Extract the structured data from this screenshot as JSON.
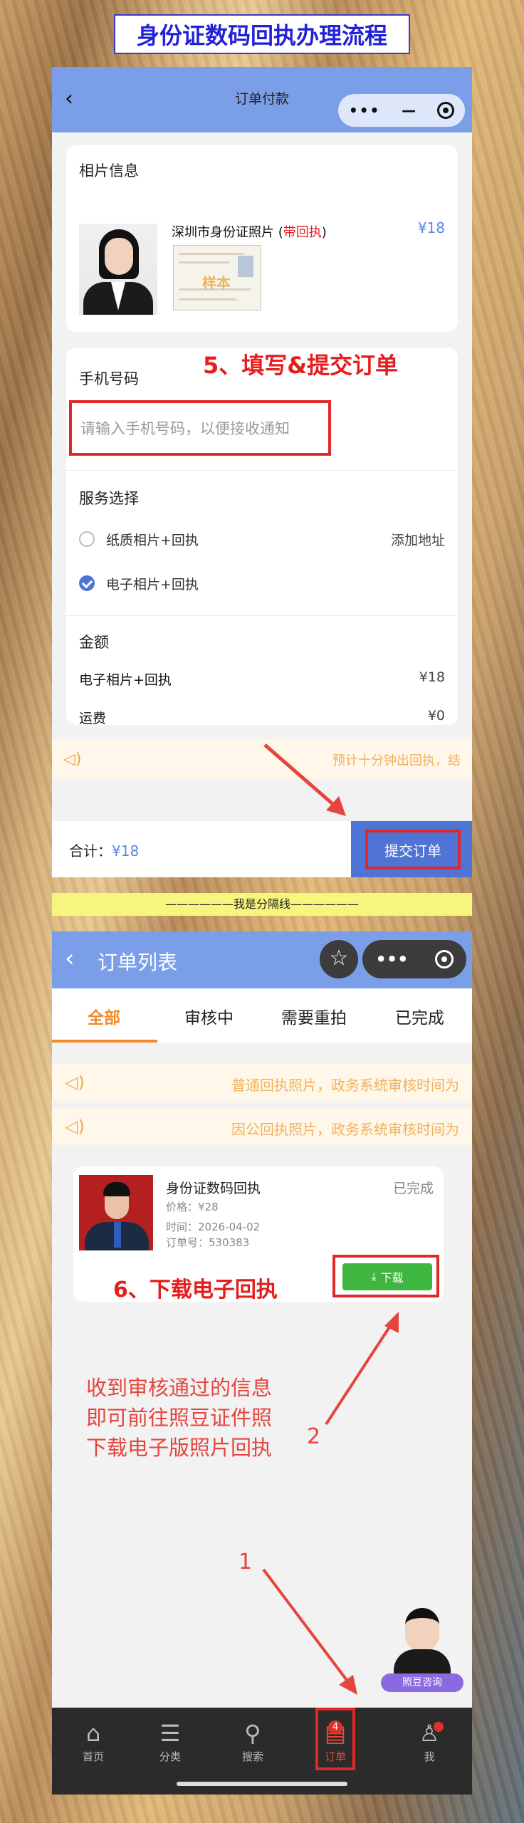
{
  "main_title": "身份证数码回执办理流程",
  "order_pay": {
    "nav_title": "订单付款",
    "photo_section_title": "相片信息",
    "product_name": "深圳市身份证照片",
    "product_tag": "带回执",
    "sample_stamp": "样本",
    "product_price": "¥18",
    "step_label": "5、填写&提交订单",
    "phone_label": "手机号码",
    "phone_placeholder": "请输入手机号码，以便接收通知",
    "service_title": "服务选择",
    "options": [
      {
        "label": "纸质相片+回执",
        "right": "添加地址",
        "selected": false
      },
      {
        "label": "电子相片+回执",
        "right": "",
        "selected": true
      }
    ],
    "amount_title": "金额",
    "amount_rows": [
      {
        "label": "电子相片+回执",
        "value": "¥18"
      },
      {
        "label": "运费",
        "value": "¥0"
      }
    ],
    "notice": "预计十分钟出回执，结",
    "total_label": "合计：",
    "total_value": "¥18",
    "submit_label": "提交订单"
  },
  "separator": "——————我是分隔线——————",
  "order_list": {
    "nav_title": "订单列表",
    "tabs": [
      "全部",
      "审核中",
      "需要重拍",
      "已完成"
    ],
    "notices": [
      "普通回执照片，政务系统审核时间为",
      "因公回执照片，政务系统审核时间为"
    ],
    "order": {
      "title": "身份证数码回执",
      "status": "已完成",
      "price": "价格：¥28",
      "time": "时间：2026-04-02",
      "order_no": "订单号：530383",
      "download_label": "下载"
    },
    "step_label": "6、下载电子回执",
    "instruction_lines": [
      "收到审核通过的信息",
      "即可前往照豆证件照",
      "下载电子版照片回执"
    ],
    "marker_1": "1",
    "marker_2": "2",
    "assistant_label": "照豆咨询",
    "tabbar": [
      {
        "label": "首页",
        "icon": "home-icon"
      },
      {
        "label": "分类",
        "icon": "list-icon"
      },
      {
        "label": "搜索",
        "icon": "search-icon"
      },
      {
        "label": "订单",
        "icon": "order-icon",
        "badge": "4"
      },
      {
        "label": "我",
        "icon": "user-icon"
      }
    ]
  },
  "colors": {
    "nav": "#7b9ee8",
    "primary": "#4f74d6",
    "highlight": "#e02828",
    "accent": "#f08a2a",
    "download": "#3fb63f"
  }
}
